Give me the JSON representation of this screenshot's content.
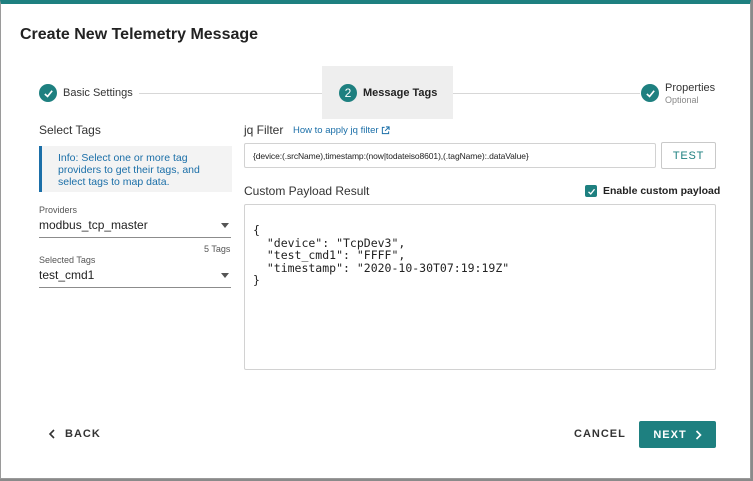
{
  "dialog": {
    "title": "Create New Telemetry Message"
  },
  "stepper": {
    "steps": [
      {
        "label": "Basic Settings",
        "state": "complete",
        "icon": "check-icon"
      },
      {
        "label": "Message Tags",
        "state": "active",
        "number": "2"
      },
      {
        "label": "Properties",
        "sublabel": "Optional",
        "state": "complete",
        "icon": "check-icon"
      }
    ]
  },
  "left": {
    "heading": "Select Tags",
    "info": "Info: Select one or more tag providers to get their tags, and select tags to map data.",
    "providers_label": "Providers",
    "providers_value": "modbus_tcp_master",
    "tag_count": "5 Tags",
    "selected_tags_label": "Selected Tags",
    "selected_tags_value": "test_cmd1"
  },
  "right": {
    "jq_label": "jq Filter",
    "jq_link": "How to apply jq filter",
    "jq_value": "{device:(.srcName),timestamp:(now|todateiso8601),(.tagName):.dataValue}",
    "test_label": "TEST",
    "payload_label": "Custom Payload Result",
    "custom_payload_label": "Enable custom payload",
    "custom_payload_checked": true,
    "payload_text": "{\n  \"device\": \"TcpDev3\",\n  \"test_cmd1\": \"FFFF\",\n  \"timestamp\": \"2020-10-30T07:19:19Z\"\n}"
  },
  "footer": {
    "back_label": "BACK",
    "cancel_label": "CANCEL",
    "next_label": "NEXT"
  },
  "colors": {
    "accent": "#1e8080",
    "link": "#1b6fa8"
  }
}
